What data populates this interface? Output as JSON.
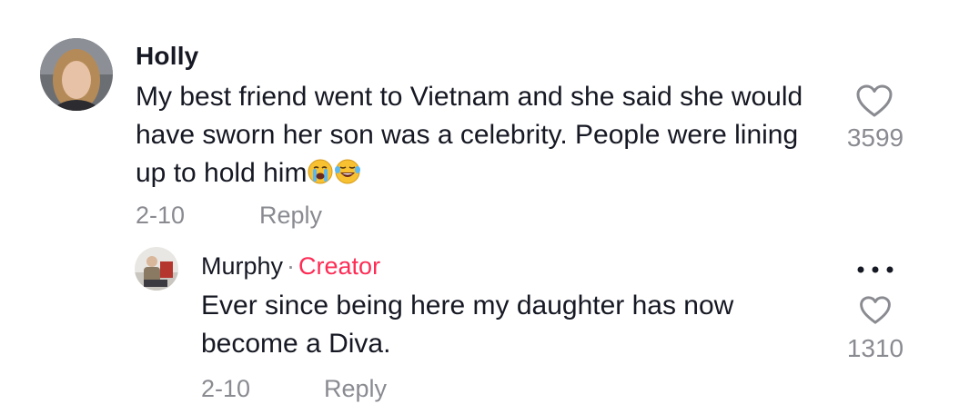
{
  "comments": [
    {
      "author": "Holly",
      "text": "My best friend went to Vietnam and she said she would have sworn her son was a celebrity. People were lining up to hold him",
      "emojis": [
        "loudly-crying-face",
        "face-with-tears-of-joy"
      ],
      "date": "2-10",
      "reply_label": "Reply",
      "likes": "3599"
    }
  ],
  "reply": {
    "author": "Murphy",
    "separator": "·",
    "badge": "Creator",
    "text": "Ever since being here my daughter has now become a Diva.",
    "date": "2-10",
    "reply_label": "Reply",
    "likes": "1310"
  },
  "colors": {
    "text_primary": "#161823",
    "text_secondary": "#8a8b91",
    "creator_accent": "#fe2c55"
  },
  "icons": [
    "heart-outline-icon",
    "more-options-icon"
  ]
}
